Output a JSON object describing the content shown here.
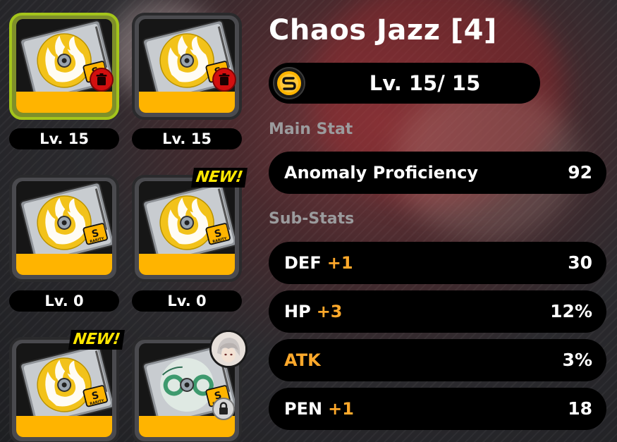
{
  "colors": {
    "accent_orange": "#ffa92b",
    "rarity_yellow": "#ffb400",
    "selected_border": "#a4c51b",
    "new_yellow": "#ffe600",
    "trash_red": "#d20f0f"
  },
  "discs": [
    {
      "level_label": "Lv. 15",
      "selected": true,
      "new": false,
      "trash": true,
      "lock": false,
      "rarity": "S",
      "design": "flame"
    },
    {
      "level_label": "Lv. 15",
      "selected": false,
      "new": false,
      "trash": true,
      "lock": false,
      "rarity": "S",
      "design": "flame"
    },
    {
      "level_label": "Lv. 0",
      "selected": false,
      "new": false,
      "trash": false,
      "lock": false,
      "rarity": "S",
      "design": "flame"
    },
    {
      "level_label": "Lv. 0",
      "selected": false,
      "new": true,
      "trash": false,
      "lock": false,
      "rarity": "S",
      "design": "flame"
    },
    {
      "level_label": "",
      "selected": false,
      "new": true,
      "trash": false,
      "lock": false,
      "rarity": "S",
      "design": "flame"
    },
    {
      "level_label": "",
      "selected": false,
      "new": false,
      "trash": false,
      "lock": true,
      "rarity": "S",
      "design": "freedom-blues",
      "equipped_avatar": true
    }
  ],
  "new_badge_label": "NEW!",
  "rarity_badge_text": "RARITY",
  "disc_name": "Chaos Jazz [4]",
  "rank_icon": "S-rank-icon",
  "level_display": "Lv. 15/ 15",
  "main_stat_label": "Main Stat",
  "main_stat": {
    "name": "Anomaly Proficiency",
    "value": "92"
  },
  "sub_stats_label": "Sub-Stats",
  "sub_stats": [
    {
      "name": "DEF",
      "plus": "+1",
      "value": "30",
      "highlight": false
    },
    {
      "name": "HP",
      "plus": "+3",
      "value": "12%",
      "highlight": false
    },
    {
      "name": "ATK",
      "plus": "",
      "value": "3%",
      "highlight": true
    },
    {
      "name": "PEN",
      "plus": "+1",
      "value": "18",
      "highlight": false
    }
  ]
}
